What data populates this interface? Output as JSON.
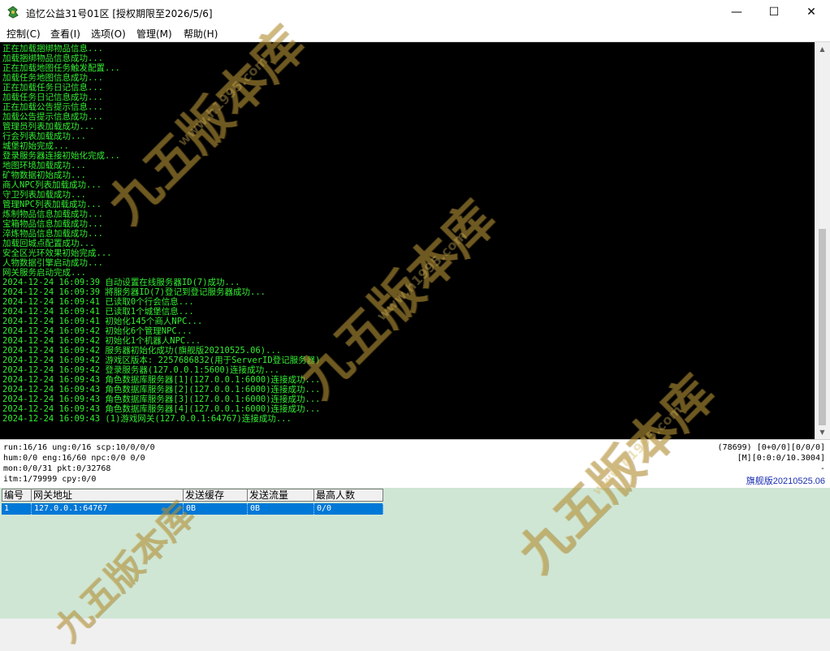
{
  "window": {
    "title": "追忆公益31号01区 [授权期限至2026/5/6]",
    "minimize_glyph": "—",
    "maximize_glyph": "☐",
    "close_glyph": "✕"
  },
  "menu": [
    "控制(C)",
    "查看(I)",
    "选项(O)",
    "管理(M)",
    "帮助(H)"
  ],
  "console": {
    "text_color": "#33ee33",
    "lines": [
      "正在加载捆绑物品信息...",
      "加载捆绑物品信息成功...",
      "正在加载地图任务触发配置...",
      "加载任务地图信息成功...",
      "正在加载任务日记信息...",
      "加载任务日记信息成功...",
      "正在加载公告提示信息...",
      "加载公告提示信息成功...",
      "管理员列表加载成功...",
      "行会列表加载成功...",
      "城堡初始完成...",
      "登录服务器连接初始化完成...",
      "地图环境加载成功...",
      "矿物数据初始成功...",
      "商人NPC列表加载成功...",
      "守卫列表加载成功...",
      "管理NPC列表加载成功...",
      "炼制物品信息加载成功...",
      "宝箱物品信息加载成功...",
      "淬炼物品信息加载成功...",
      "加载回城点配置成功...",
      "安全区光环效果初始完成...",
      "人物数据引擎启动成功...",
      "网关服务启动完成...",
      "2024-12-24 16:09:39 自动设置在线服务器ID(7)成功...",
      "2024-12-24 16:09:39 將服务器ID(7)登记到登记服务器成功...",
      "2024-12-24 16:09:41 已读取0个行会信息...",
      "2024-12-24 16:09:41 已读取1个城堡信息...",
      "2024-12-24 16:09:41 初始化145个商人NPC...",
      "2024-12-24 16:09:42 初始化6个管理NPC...",
      "2024-12-24 16:09:42 初始化1个机器人NPC...",
      "2024-12-24 16:09:42 服务器初始化成功(旗舰版20210525.06)...",
      "2024-12-24 16:09:42 游戏区版本: 2257686832(用于ServerID登记服务器)",
      "2024-12-24 16:09:42 登录服务器(127.0.0.1:5600)连接成功...",
      "2024-12-24 16:09:43 角色数据库服务器[1](127.0.0.1:6000)连接成功...",
      "2024-12-24 16:09:43 角色数据库服务器[2](127.0.0.1:6000)连接成功...",
      "2024-12-24 16:09:43 角色数据库服务器[3](127.0.0.1:6000)连接成功...",
      "2024-12-24 16:09:43 角色数据库服务器[4](127.0.0.1:6000)连接成功...",
      "2024-12-24 16:09:43 (1)游戏网关(127.0.0.1:64767)连接成功..."
    ]
  },
  "status": {
    "left": [
      "run:16/16 ung:0/16 scp:10/0/0/0",
      "hum:0/0 eng:16/60 npc:0/0 0/0",
      "mon:0/0/31 pkt:0/32768",
      "itm:1/79999 cpy:0/0"
    ],
    "right": [
      "(78699) [0+0/0][0/0/0]",
      "[M][0:0:0/10.3004]",
      "-"
    ],
    "version": "旗舰版20210525.06",
    "version_color": "#1a2fb0"
  },
  "gateway_table": {
    "columns": [
      "编号",
      "网关地址",
      "发送缓存",
      "发送流量",
      "最高人数"
    ],
    "rows": [
      [
        "1",
        "127.0.0.1:64767",
        "0B",
        "0B",
        "0/0"
      ]
    ],
    "selected_color": "#0078d7",
    "background": "#cfe6d4"
  },
  "watermark": {
    "text": "九五版本库",
    "url": "www.h1995.com"
  }
}
